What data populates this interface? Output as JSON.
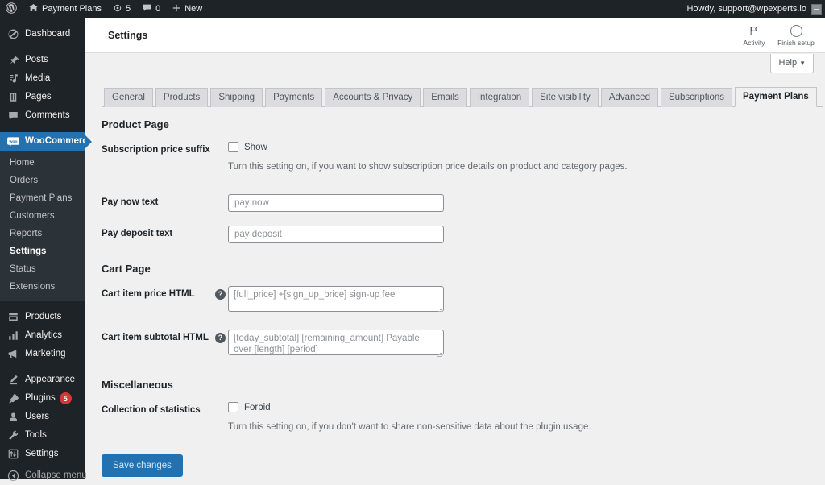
{
  "adminbar": {
    "logo_icon": "wordpress-logo-icon",
    "site_icon": "home-icon",
    "site_name": "Payment Plans",
    "updates_icon": "updates-icon",
    "updates_count": "5",
    "comments_icon": "comments-icon",
    "comments_count": "0",
    "new_icon": "plus-icon",
    "new_label": "New",
    "howdy": "Howdy, support@wpexperts.io",
    "avatar_icon": "user-avatar"
  },
  "sidebar": {
    "items": [
      {
        "label": "Dashboard",
        "icon": "dashboard-icon",
        "name": "dashboard"
      },
      {
        "label": "Posts",
        "icon": "pin-icon",
        "name": "posts"
      },
      {
        "label": "Media",
        "icon": "media-icon",
        "name": "media"
      },
      {
        "label": "Pages",
        "icon": "page-icon",
        "name": "pages"
      },
      {
        "label": "Comments",
        "icon": "comment-icon",
        "name": "comments"
      },
      {
        "label": "WooCommerce",
        "icon": "woocommerce-icon",
        "name": "woocommerce",
        "current": true
      },
      {
        "label": "Products",
        "icon": "products-icon",
        "name": "products"
      },
      {
        "label": "Analytics",
        "icon": "analytics-icon",
        "name": "analytics"
      },
      {
        "label": "Marketing",
        "icon": "marketing-icon",
        "name": "marketing"
      },
      {
        "label": "Appearance",
        "icon": "appearance-icon",
        "name": "appearance"
      },
      {
        "label": "Plugins",
        "icon": "plugins-icon",
        "name": "plugins",
        "badge": "5"
      },
      {
        "label": "Users",
        "icon": "users-icon",
        "name": "users"
      },
      {
        "label": "Tools",
        "icon": "tools-icon",
        "name": "tools"
      },
      {
        "label": "Settings",
        "icon": "settings-icon",
        "name": "settings"
      }
    ],
    "woocommerce_submenu": [
      {
        "label": "Home",
        "name": "home"
      },
      {
        "label": "Orders",
        "name": "orders"
      },
      {
        "label": "Payment Plans",
        "name": "payment-plans"
      },
      {
        "label": "Customers",
        "name": "customers"
      },
      {
        "label": "Reports",
        "name": "reports"
      },
      {
        "label": "Settings",
        "name": "settings",
        "current": true
      },
      {
        "label": "Status",
        "name": "status"
      },
      {
        "label": "Extensions",
        "name": "extensions"
      }
    ],
    "collapse_label": "Collapse menu",
    "collapse_icon": "collapse-icon"
  },
  "header": {
    "title": "Settings",
    "activity_label": "Activity",
    "activity_icon": "flag-icon",
    "setup_label": "Finish setup",
    "setup_icon": "progress-ring-icon",
    "help_label": "Help",
    "help_caret_icon": "chevron-down-icon"
  },
  "tabs": [
    {
      "label": "General",
      "name": "general"
    },
    {
      "label": "Products",
      "name": "products"
    },
    {
      "label": "Shipping",
      "name": "shipping"
    },
    {
      "label": "Payments",
      "name": "payments"
    },
    {
      "label": "Accounts & Privacy",
      "name": "accounts-privacy"
    },
    {
      "label": "Emails",
      "name": "emails"
    },
    {
      "label": "Integration",
      "name": "integration"
    },
    {
      "label": "Site visibility",
      "name": "site-visibility"
    },
    {
      "label": "Advanced",
      "name": "advanced"
    },
    {
      "label": "Subscriptions",
      "name": "subscriptions"
    },
    {
      "label": "Payment Plans",
      "name": "payment-plans",
      "active": true
    }
  ],
  "form": {
    "product_page": {
      "title": "Product Page",
      "suffix_label": "Subscription price suffix",
      "suffix_checkbox_label": "Show",
      "suffix_desc": "Turn this setting on, if you want to show subscription price details on product and category pages.",
      "pay_now_label": "Pay now text",
      "pay_now_placeholder": "pay now",
      "pay_now_value": "",
      "pay_deposit_label": "Pay deposit text",
      "pay_deposit_placeholder": "pay deposit",
      "pay_deposit_value": ""
    },
    "cart_page": {
      "title": "Cart Page",
      "price_html_label": "Cart item price HTML",
      "price_html_help_icon": "help-icon",
      "price_html_placeholder": "[full_price] +[sign_up_price] sign-up fee",
      "price_html_value": "",
      "subtotal_html_label": "Cart item subtotal HTML",
      "subtotal_html_help_icon": "help-icon",
      "subtotal_html_placeholder": "[today_subtotal] [remaining_amount] Payable over [length] [period]",
      "subtotal_html_value": ""
    },
    "miscellaneous": {
      "title": "Miscellaneous",
      "stats_label": "Collection of statistics",
      "stats_checkbox_label": "Forbid",
      "stats_desc": "Turn this setting on, if you don't want to share non-sensitive data about the plugin usage."
    },
    "save_label": "Save changes"
  },
  "colors": {
    "admin_dark": "#1d2327",
    "submenu_dark": "#2c3338",
    "accent_blue": "#2271b1",
    "badge_red": "#d63638",
    "body_bg": "#f0f0f1"
  }
}
